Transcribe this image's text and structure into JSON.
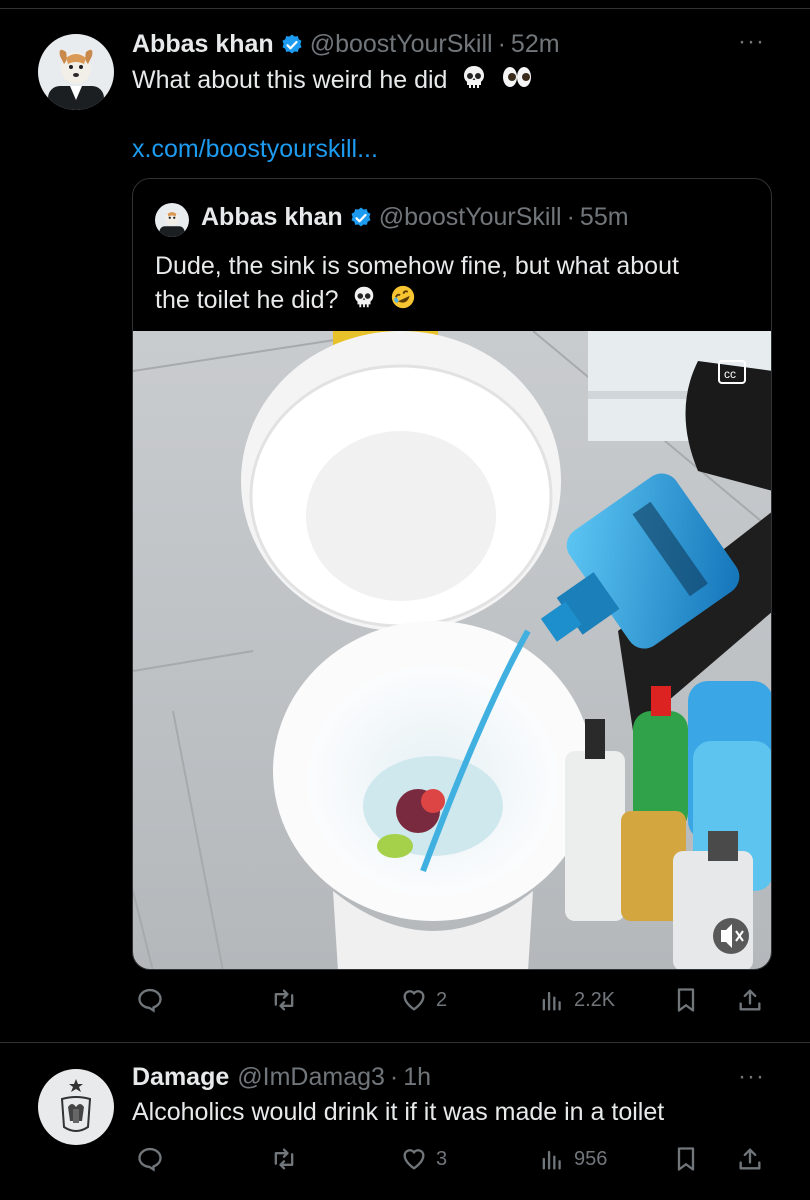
{
  "tweet1": {
    "name": "Abbas khan",
    "handle": "@boostYourSkill",
    "separator": "·",
    "time": "52m",
    "text": "What about this weird he did",
    "link": "x.com/boostyourskill...",
    "more": "···",
    "quote": {
      "name": "Abbas khan",
      "handle": "@boostYourSkill",
      "separator": "·",
      "time": "55m",
      "text_line1": "Dude, the sink is somehow fine, but what about",
      "text_line2": "the toilet he did?"
    },
    "stats": {
      "replies": "",
      "reposts": "",
      "likes": "2",
      "views": "2.2K"
    },
    "icons": {
      "reply": "reply-icon",
      "repost": "repost-icon",
      "like": "heart-icon",
      "views": "views-icon",
      "bookmark": "bookmark-icon",
      "share": "share-icon",
      "captions": "captions-icon",
      "mute": "mute-icon"
    }
  },
  "tweet2": {
    "name": "Damage",
    "handle": "@ImDamag3",
    "separator": "·",
    "time": "1h",
    "text": "Alcoholics would drink it if it was made in a toilet",
    "more": "···",
    "stats": {
      "replies": "",
      "reposts": "",
      "likes": "3",
      "views": "956"
    }
  },
  "colors": {
    "background": "#000000",
    "text": "#e7e9ea",
    "secondary": "#71767b",
    "link": "#1d9bf0",
    "verified": "#1d9bf0",
    "border": "#2f3336"
  }
}
